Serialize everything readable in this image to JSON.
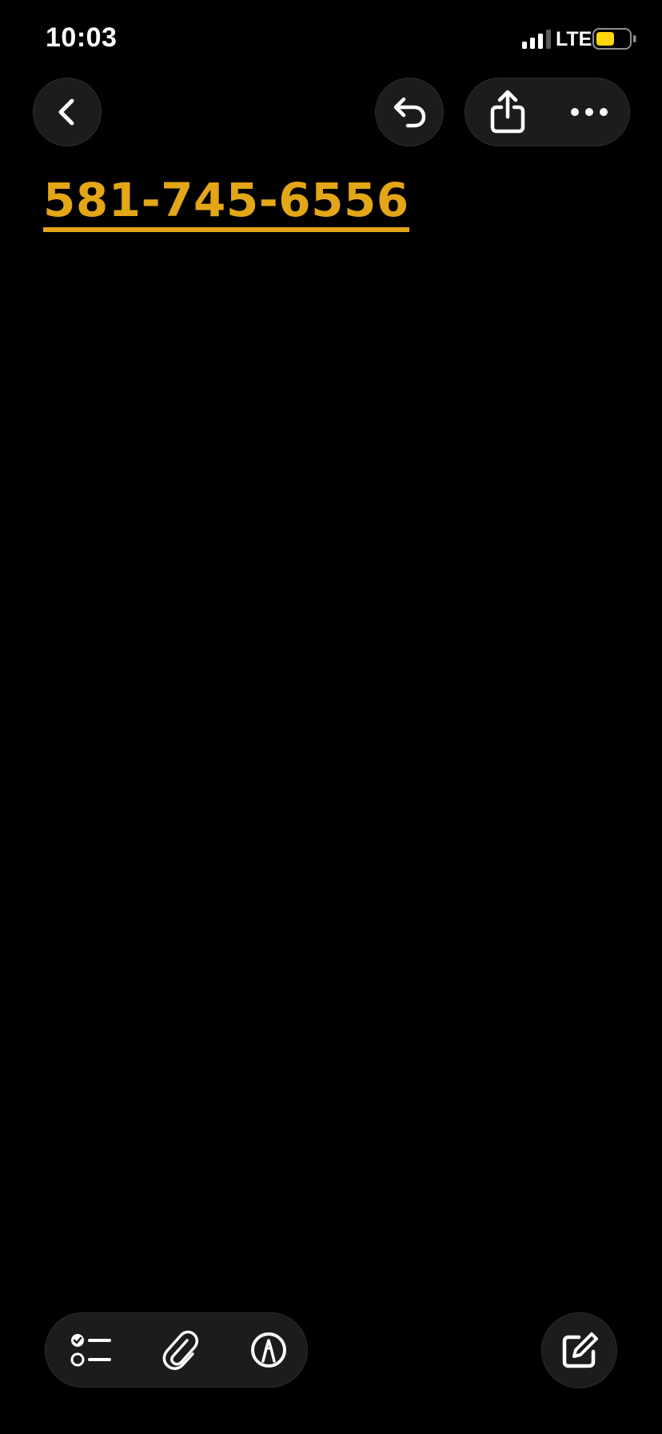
{
  "status_bar": {
    "time": "10:03",
    "network": "LTE",
    "battery_color": "#ffd60a"
  },
  "toolbar": {
    "back_icon": "chevron-left-icon",
    "undo_icon": "undo-icon",
    "share_icon": "share-icon",
    "more_icon": "ellipsis-icon"
  },
  "note": {
    "phone_number": "581-745-6556",
    "link_color": "#e3a617"
  },
  "bottom_toolbar": {
    "checklist_icon": "checklist-icon",
    "attach_icon": "paperclip-icon",
    "markup_icon": "markup-pen-icon",
    "compose_icon": "compose-icon"
  }
}
